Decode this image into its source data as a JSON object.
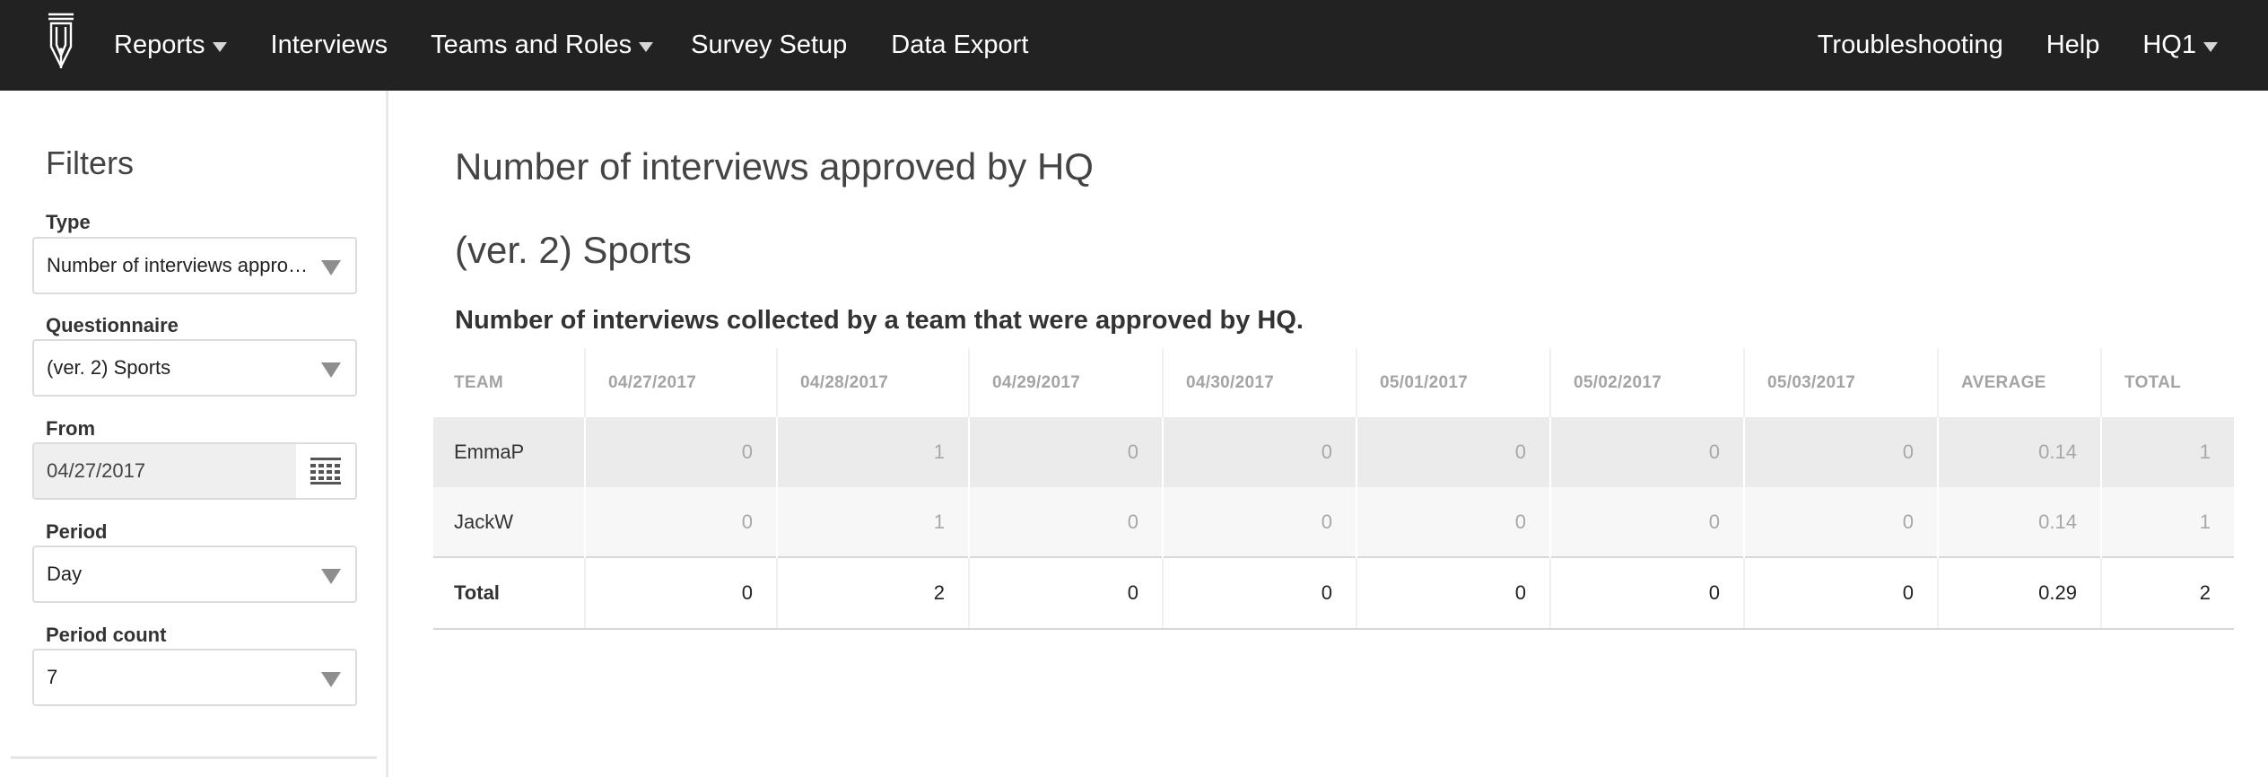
{
  "nav": {
    "left": [
      {
        "label": "Reports",
        "dropdown": true
      },
      {
        "label": "Interviews",
        "dropdown": false
      },
      {
        "label": "Teams and Roles",
        "dropdown": true
      },
      {
        "label": "Survey Setup",
        "dropdown": false
      },
      {
        "label": "Data Export",
        "dropdown": false
      }
    ],
    "right": [
      {
        "label": "Troubleshooting",
        "dropdown": false
      },
      {
        "label": "Help",
        "dropdown": false
      },
      {
        "label": "HQ1",
        "dropdown": true
      }
    ]
  },
  "sidebar": {
    "title": "Filters",
    "type": {
      "label": "Type",
      "value": "Number of interviews approved by HQ"
    },
    "questionnaire": {
      "label": "Questionnaire",
      "value": "(ver. 2) Sports"
    },
    "from": {
      "label": "From",
      "value": "04/27/2017"
    },
    "period": {
      "label": "Period",
      "value": "Day"
    },
    "period_count": {
      "label": "Period count",
      "value": "7"
    }
  },
  "main": {
    "title": "Number of interviews approved by HQ",
    "subtitle": "(ver. 2) Sports",
    "caption": "Number of interviews collected by a team that were approved by HQ."
  },
  "table": {
    "headers": [
      "TEAM",
      "04/27/2017",
      "04/28/2017",
      "04/29/2017",
      "04/30/2017",
      "05/01/2017",
      "05/02/2017",
      "05/03/2017",
      "AVERAGE",
      "TOTAL"
    ],
    "rows": [
      [
        "EmmaP",
        "0",
        "1",
        "0",
        "0",
        "0",
        "0",
        "0",
        "0.14",
        "1"
      ],
      [
        "JackW",
        "0",
        "1",
        "0",
        "0",
        "0",
        "0",
        "0",
        "0.14",
        "1"
      ]
    ],
    "total": [
      "Total",
      "0",
      "2",
      "0",
      "0",
      "0",
      "0",
      "0",
      "0.29",
      "2"
    ]
  },
  "colors": {
    "navbar": "#222222",
    "row_odd": "#ebebeb",
    "row_even": "#f7f7f7"
  }
}
